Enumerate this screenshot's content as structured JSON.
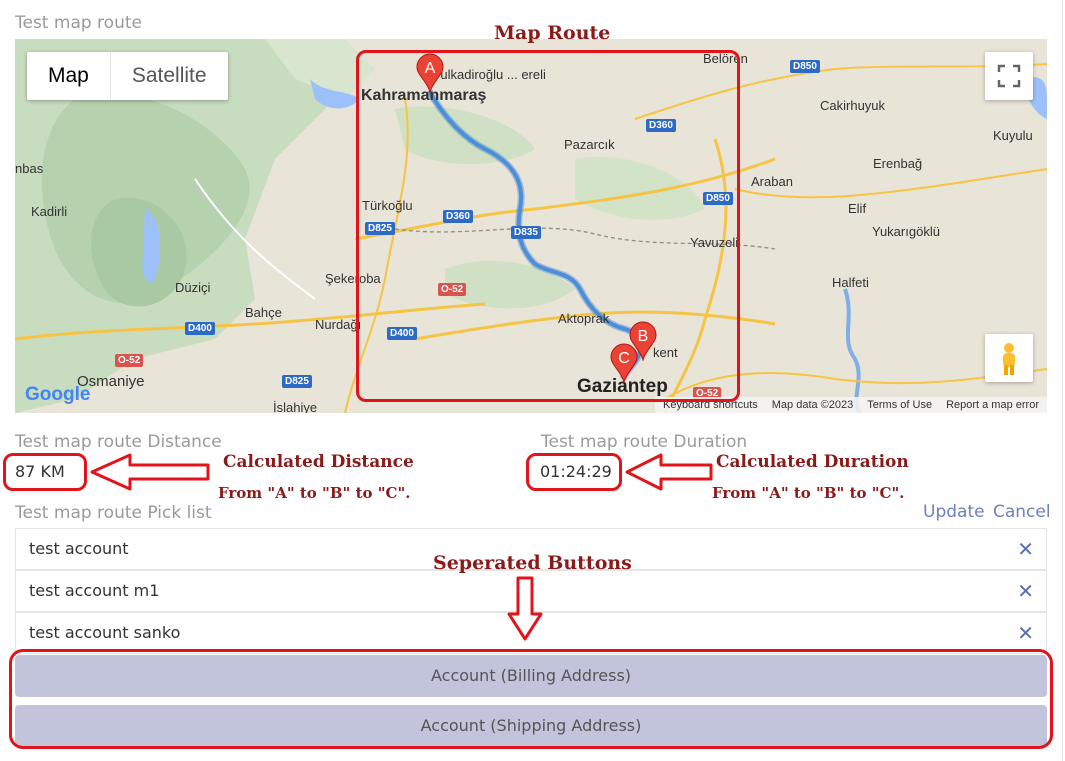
{
  "map_field": {
    "label": "Test map route",
    "map_type": {
      "map": "Map",
      "satellite": "Satellite"
    },
    "places": [
      {
        "name": "Kahramanmaraş"
      },
      {
        "name": "Dulkadiroğlu ... ereli"
      },
      {
        "name": "Pazarcık"
      },
      {
        "name": "Türkoğlu"
      },
      {
        "name": "Kadirli"
      },
      {
        "name": "Düziçi"
      },
      {
        "name": "Bahçe"
      },
      {
        "name": "Nurdağı"
      },
      {
        "name": "Şekeroba"
      },
      {
        "name": "Osmaniye"
      },
      {
        "name": "İslahiye"
      },
      {
        "name": "Aktoprak"
      },
      {
        "name": "Gaziantep"
      },
      {
        "name": "Belören"
      },
      {
        "name": "Cakirhuyuk"
      },
      {
        "name": "Kuyulu"
      },
      {
        "name": "Erenbağ"
      },
      {
        "name": "Araban"
      },
      {
        "name": "Elif"
      },
      {
        "name": "Yukarıgöklü"
      },
      {
        "name": "Yavuzeli"
      },
      {
        "name": "Halfeti"
      },
      {
        "name": "nbas"
      },
      {
        "name": "kent"
      }
    ],
    "roads": [
      "D850",
      "D360",
      "D825",
      "D835",
      "O-52",
      "D400",
      "D360",
      "D850",
      "D400",
      "D825",
      "O-52",
      "O-52"
    ],
    "markers": [
      "A",
      "B",
      "C"
    ],
    "google_logo": "Google",
    "footer": {
      "shortcuts": "Keyboard shortcuts",
      "map_data": "Map data ©2023",
      "terms": "Terms of Use",
      "report": "Report a map error"
    }
  },
  "distance": {
    "label": "Test map route Distance",
    "value": "87 KM"
  },
  "duration": {
    "label": "Test map route Duration",
    "value": "01:24:29"
  },
  "picklist": {
    "label": "Test map route Pick list",
    "update": "Update",
    "cancel": "Cancel",
    "items": [
      {
        "name": "test account",
        "remove": "✕"
      },
      {
        "name": "test account m1",
        "remove": "✕"
      },
      {
        "name": "test account sanko",
        "remove": "✕"
      }
    ],
    "buttons": [
      {
        "label": "Account (Billing Address)"
      },
      {
        "label": "Account (Shipping Address)"
      }
    ]
  },
  "annotations": {
    "map_route": "Map Route",
    "calc_distance": "Calculated Distance",
    "calc_distance_sub": "From \"A\" to \"B\" to \"C\".",
    "calc_duration": "Calculated Duration",
    "calc_duration_sub": "From \"A\" to \"B\" to \"C\".",
    "separated_buttons": "Seperated Buttons"
  },
  "colors": {
    "annotation_red": "#e3131b",
    "annotation_text": "#8b1a1a",
    "route_blue": "#4a8fd9",
    "marker_red": "#ea4335",
    "button_bg": "#c1c4db",
    "link_blue": "#6b7fc1"
  }
}
